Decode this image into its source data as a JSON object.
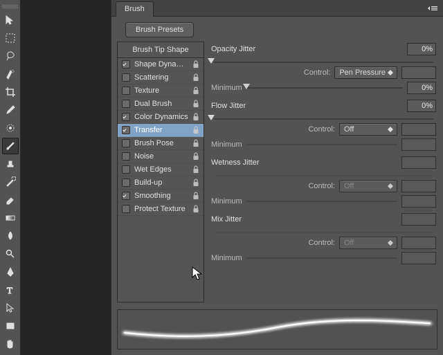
{
  "panel": {
    "tab": "Brush",
    "presets_button": "Brush Presets",
    "tip_shape_header": "Brush Tip Shape",
    "options": [
      {
        "label": "Shape Dynamics",
        "checked": true,
        "locked": true
      },
      {
        "label": "Scattering",
        "checked": false,
        "locked": true
      },
      {
        "label": "Texture",
        "checked": false,
        "locked": true
      },
      {
        "label": "Dual Brush",
        "checked": false,
        "locked": true
      },
      {
        "label": "Color Dynamics",
        "checked": true,
        "locked": true
      },
      {
        "label": "Transfer",
        "checked": true,
        "locked": true,
        "selected": true
      },
      {
        "label": "Brush Pose",
        "checked": false,
        "locked": true
      },
      {
        "label": "Noise",
        "checked": false,
        "locked": true
      },
      {
        "label": "Wet Edges",
        "checked": false,
        "locked": true
      },
      {
        "label": "Build-up",
        "checked": false,
        "locked": true
      },
      {
        "label": "Smoothing",
        "checked": true,
        "locked": true
      },
      {
        "label": "Protect Texture",
        "checked": false,
        "locked": true
      }
    ]
  },
  "controls": {
    "opacity_jitter": {
      "label": "Opacity Jitter",
      "value": "0%",
      "thumb_pct": 0
    },
    "opacity_control_label": "Control:",
    "opacity_control_value": "Pen Pressure",
    "opacity_minimum_label": "Minimum",
    "opacity_minimum_value": "0%",
    "opacity_minimum_thumb_pct": 0,
    "flow_jitter": {
      "label": "Flow Jitter",
      "value": "0%",
      "thumb_pct": 0
    },
    "flow_control_label": "Control:",
    "flow_control_value": "Off",
    "flow_minimum_label": "Minimum",
    "wetness_jitter_label": "Wetness Jitter",
    "wetness_control_label": "Control:",
    "wetness_control_value": "Off",
    "wetness_minimum_label": "Minimum",
    "mix_jitter_label": "Mix Jitter",
    "mix_control_label": "Control:",
    "mix_control_value": "Off",
    "mix_minimum_label": "Minimum"
  },
  "tools": [
    "move-tool",
    "marquee-tool",
    "lasso-tool",
    "quick-select-tool",
    "crop-tool",
    "eyedropper-tool",
    "healing-brush-tool",
    "brush-tool",
    "clone-stamp-tool",
    "history-brush-tool",
    "eraser-tool",
    "gradient-tool",
    "blur-tool",
    "dodge-tool",
    "pen-tool",
    "type-tool",
    "path-select-tool",
    "rectangle-tool",
    "hand-tool"
  ],
  "selected_tool_index": 7
}
